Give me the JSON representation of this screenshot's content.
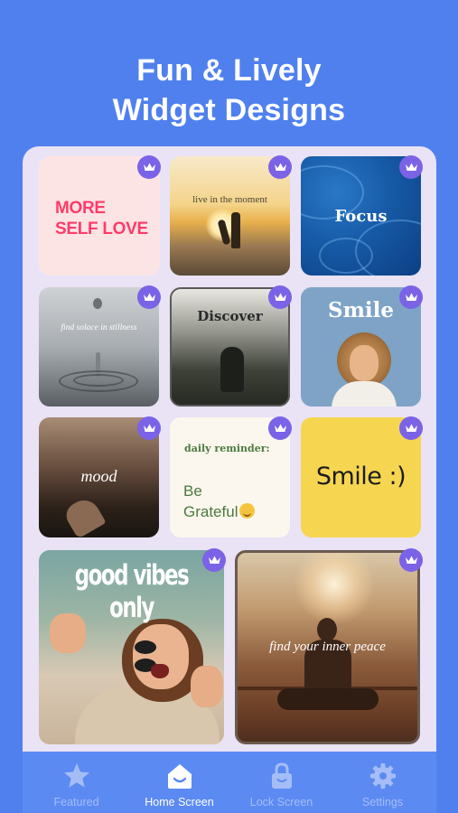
{
  "headline": {
    "line1": "Fun & Lively",
    "line2": "Widget Designs"
  },
  "widgets": [
    {
      "text": "MORE SELF LOVE",
      "line1": "MORE",
      "line2": "SELF LOVE",
      "premium": true
    },
    {
      "text": "live in the moment",
      "premium": true
    },
    {
      "text": "Focus",
      "premium": true
    },
    {
      "text": "find solace in stillness",
      "premium": true
    },
    {
      "text": "Discover",
      "premium": true
    },
    {
      "text": "Smile",
      "premium": true
    },
    {
      "text": "mood",
      "premium": true
    },
    {
      "title": "daily reminder:",
      "line1": "Be",
      "line2": "Grateful",
      "emoji": "relieved-face",
      "premium": true
    },
    {
      "text": "Smile :)",
      "premium": true
    },
    {
      "text": "good vibes only",
      "premium": true
    },
    {
      "text": "find your inner peace",
      "premium": true
    }
  ],
  "tabs": [
    {
      "label": "Featured",
      "icon": "star-icon",
      "active": false
    },
    {
      "label": "Home Screen",
      "icon": "home-smile-icon",
      "active": true
    },
    {
      "label": "Lock Screen",
      "icon": "lock-icon",
      "active": false
    },
    {
      "label": "Settings",
      "icon": "gear-icon",
      "active": false
    }
  ],
  "colors": {
    "background": "#4f80ee",
    "panel": "#e9e3f5",
    "crown_badge": "#7a63e6",
    "tab_active": "#ffffff",
    "tab_inactive": "#a5bdf6"
  }
}
